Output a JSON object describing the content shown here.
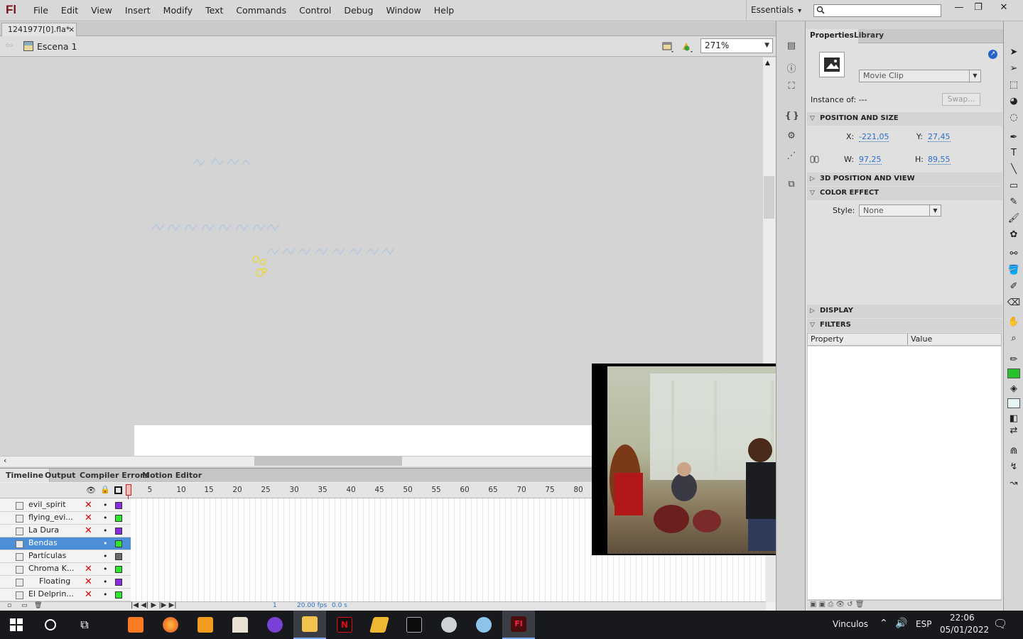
{
  "app": {
    "logo": "Fl",
    "menu": [
      "File",
      "Edit",
      "View",
      "Insert",
      "Modify",
      "Text",
      "Commands",
      "Control",
      "Debug",
      "Window",
      "Help"
    ],
    "workspace": "Essentials"
  },
  "document": {
    "tab": "1241977[0].fla*",
    "close": "×",
    "scene": "Escena 1",
    "zoom": "271%"
  },
  "window_buttons": {
    "minimize": "—",
    "restore": "❐",
    "close": "✕"
  },
  "panel_tabs": [
    "Timeline",
    "Output",
    "Compiler Errors",
    "Motion Editor"
  ],
  "timeline": {
    "frames": [
      "1",
      "5",
      "10",
      "15",
      "20",
      "25",
      "30",
      "35",
      "40",
      "45",
      "50",
      "55",
      "60",
      "65",
      "70",
      "75",
      "80"
    ],
    "layers": [
      {
        "name": "evil_spirit",
        "color": "#8a2be2",
        "hidden": true
      },
      {
        "name": "flying_evi...",
        "color": "#2ee82e",
        "hidden": true
      },
      {
        "name": "La Dura",
        "color": "#8a2be2",
        "hidden": true
      },
      {
        "name": "Bendas",
        "color": "#2ee82e",
        "hidden": false,
        "selected": true
      },
      {
        "name": "Partículas",
        "color": "#6b6b6b",
        "hidden": false
      },
      {
        "name": "Chroma K...",
        "color": "#2ee82e",
        "hidden": true
      },
      {
        "name": "Floating",
        "color": "#8a2be2",
        "hidden": true
      },
      {
        "name": "El Delprin...",
        "color": "#2ee82e",
        "hidden": true
      }
    ],
    "footer": {
      "frame": "1",
      "fps": "20.00 fps",
      "time": "0.0 s"
    }
  },
  "properties": {
    "tabs": [
      "Properties",
      "Library"
    ],
    "symbol_type": "Movie Clip",
    "instance_label": "Instance of:",
    "instance_value": "---",
    "swap": "Swap...",
    "sections": {
      "position": "POSITION AND SIZE",
      "three_d": "3D POSITION AND VIEW",
      "color": "COLOR EFFECT",
      "display": "DISPLAY",
      "filters": "FILTERS"
    },
    "x_label": "X:",
    "x": "-221,05",
    "y_label": "Y:",
    "y": "27,45",
    "w_label": "W:",
    "w": "97,25",
    "h_label": "H:",
    "h": "89,55",
    "style_label": "Style:",
    "style": "None",
    "filter_cols": [
      "Property",
      "Value"
    ]
  },
  "taskbar": {
    "lang": "ESP",
    "link": "Vinculos",
    "time": "22:06",
    "date": "05/01/2022"
  }
}
